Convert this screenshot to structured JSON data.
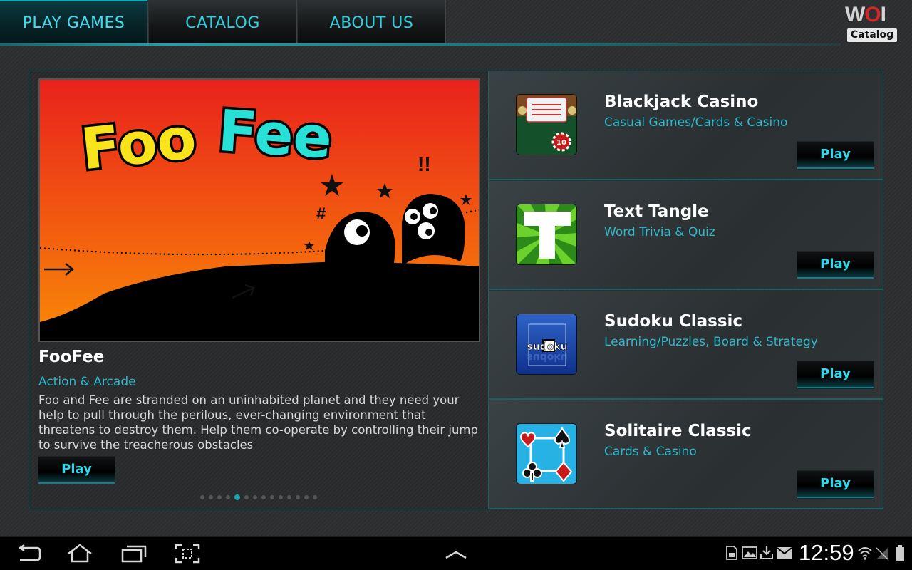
{
  "tabs": [
    {
      "label": "PLAY GAMES",
      "active": true
    },
    {
      "label": "CATALOG",
      "active": false
    },
    {
      "label": "ABOUT US",
      "active": false
    }
  ],
  "logo": {
    "brand": "WOI",
    "subtitle": "Catalog"
  },
  "featured": {
    "banner_text": "FooFee",
    "title": "FooFee",
    "category": "Action & Arcade",
    "description": "Foo and Fee are stranded on an uninhabited planet and they need your help to pull through the perilous, ever-changing environment that threatens to destroy them. Help them co-operate by controlling their jump to survive the treacherous obstacles",
    "play_label": "Play",
    "pager": {
      "count": 14,
      "active_index": 4
    }
  },
  "games": [
    {
      "title": "Blackjack Casino",
      "category": "Casual Games/Cards & Casino",
      "play_label": "Play",
      "icon": "blackjack-icon"
    },
    {
      "title": "Text Tangle",
      "category": "Word Trivia & Quiz",
      "play_label": "Play",
      "icon": "text-tangle-icon"
    },
    {
      "title": "Sudoku Classic",
      "category": "Learning/Puzzles, Board & Strategy",
      "play_label": "Play",
      "icon": "sudoku-icon",
      "icon_text": "sudoku"
    },
    {
      "title": "Solitaire Classic",
      "category": "Cards & Casino",
      "play_label": "Play",
      "icon": "solitaire-icon"
    }
  ],
  "status_bar": {
    "time": "12:59",
    "nav_icons": [
      "back-icon",
      "home-icon",
      "recent-apps-icon",
      "screenshot-icon",
      "chevron-up-icon"
    ],
    "status_icons": [
      "sd-card-icon",
      "gallery-icon",
      "download-icon",
      "gmail-icon",
      "wifi-icon",
      "signal-icon",
      "battery-icon"
    ]
  },
  "colors": {
    "accent": "#2fd8ea",
    "category": "#2fb8cc",
    "border": "#1c5f67"
  }
}
